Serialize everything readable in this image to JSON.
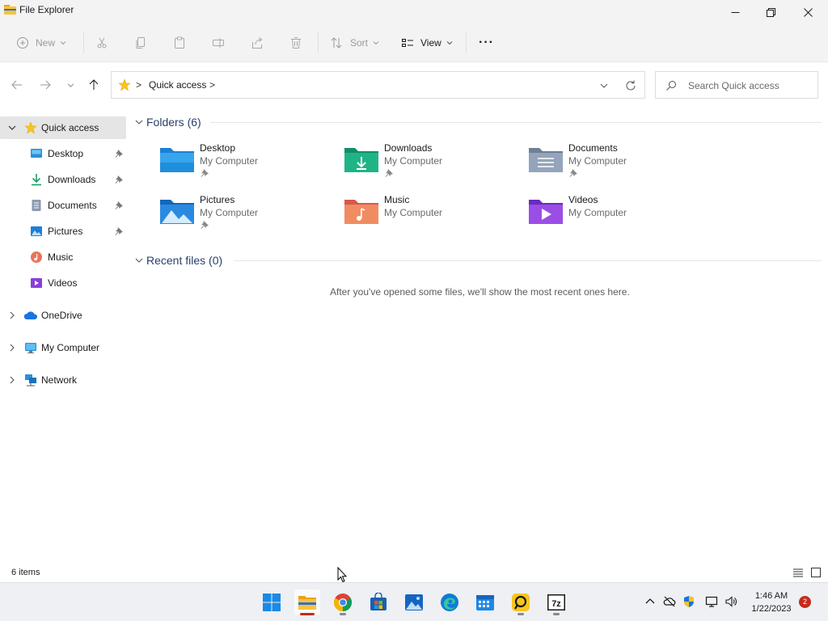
{
  "window": {
    "title": "File Explorer"
  },
  "command_bar": {
    "new_label": "New",
    "sort_label": "Sort",
    "view_label": "View",
    "more_label": "···"
  },
  "address": {
    "crumb_sep": ">",
    "location": "Quick access",
    "search_placeholder": "Search Quick access"
  },
  "sidebar": {
    "items": [
      {
        "label": "Quick access"
      },
      {
        "label": "Desktop"
      },
      {
        "label": "Downloads"
      },
      {
        "label": "Documents"
      },
      {
        "label": "Pictures"
      },
      {
        "label": "Music"
      },
      {
        "label": "Videos"
      },
      {
        "label": "OneDrive"
      },
      {
        "label": "My Computer"
      },
      {
        "label": "Network"
      }
    ]
  },
  "main": {
    "folders_heading": "Folders (6)",
    "recent_heading": "Recent files (0)",
    "empty_message": "After you've opened some files, we'll show the most recent ones here.",
    "folders": [
      {
        "name": "Desktop",
        "location": "My Computer"
      },
      {
        "name": "Downloads",
        "location": "My Computer"
      },
      {
        "name": "Documents",
        "location": "My Computer"
      },
      {
        "name": "Pictures",
        "location": "My Computer"
      },
      {
        "name": "Music",
        "location": "My Computer"
      },
      {
        "name": "Videos",
        "location": "My Computer"
      }
    ]
  },
  "status_bar": {
    "item_count": "6 items"
  },
  "taskbar": {
    "clock_time": "1:46 AM",
    "clock_date": "1/22/2023",
    "notification_count": "2",
    "apps": [
      "start",
      "file-explorer",
      "chrome",
      "microsoft-store",
      "photos",
      "edge",
      "calendar",
      "app",
      "7zip"
    ]
  },
  "colors": {
    "accent": "#0067c0",
    "chrome_bg": "#f3f3f3",
    "folder_heading": "#2a3f6b",
    "badge_red": "#c42b1c"
  }
}
